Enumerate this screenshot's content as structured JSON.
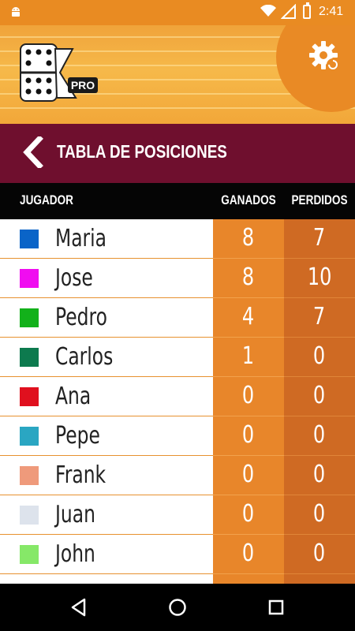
{
  "status_bar": {
    "time": "2:41",
    "icons": [
      "android-icon",
      "wifi-icon",
      "signal-icon",
      "battery-charging-icon"
    ]
  },
  "header": {
    "logo_badge": "PRO",
    "settings_icon": "gear-icon"
  },
  "title_bar": {
    "title": "TABLA DE POSICIONES",
    "back_icon": "chevron-left-icon"
  },
  "table": {
    "columns": {
      "player": "JUGADOR",
      "won": "GANADOS",
      "lost": "PERDIDOS"
    },
    "rows": [
      {
        "name": "Maria",
        "color": "#0a64c8",
        "won": "8",
        "lost": "7"
      },
      {
        "name": "Jose",
        "color": "#f00cf0",
        "won": "8",
        "lost": "10"
      },
      {
        "name": "Pedro",
        "color": "#12b11a",
        "won": "4",
        "lost": "7"
      },
      {
        "name": "Carlos",
        "color": "#0d7a4e",
        "won": "1",
        "lost": "0"
      },
      {
        "name": "Ana",
        "color": "#e0101e",
        "won": "0",
        "lost": "0"
      },
      {
        "name": "Pepe",
        "color": "#2aa6c2",
        "won": "0",
        "lost": "0"
      },
      {
        "name": "Frank",
        "color": "#ef9a7b",
        "won": "0",
        "lost": "0"
      },
      {
        "name": "Juan",
        "color": "#dde3ec",
        "won": "0",
        "lost": "0"
      },
      {
        "name": "John",
        "color": "#86e868",
        "won": "0",
        "lost": "0"
      }
    ]
  },
  "colors": {
    "accent_orange": "#e98b22",
    "title_bar": "#6f0f2e",
    "won_column": "#e8862a",
    "lost_column": "#cf6a23"
  },
  "nav_bar": {
    "icons": [
      "back-triangle-icon",
      "home-circle-icon",
      "recents-square-icon"
    ]
  }
}
